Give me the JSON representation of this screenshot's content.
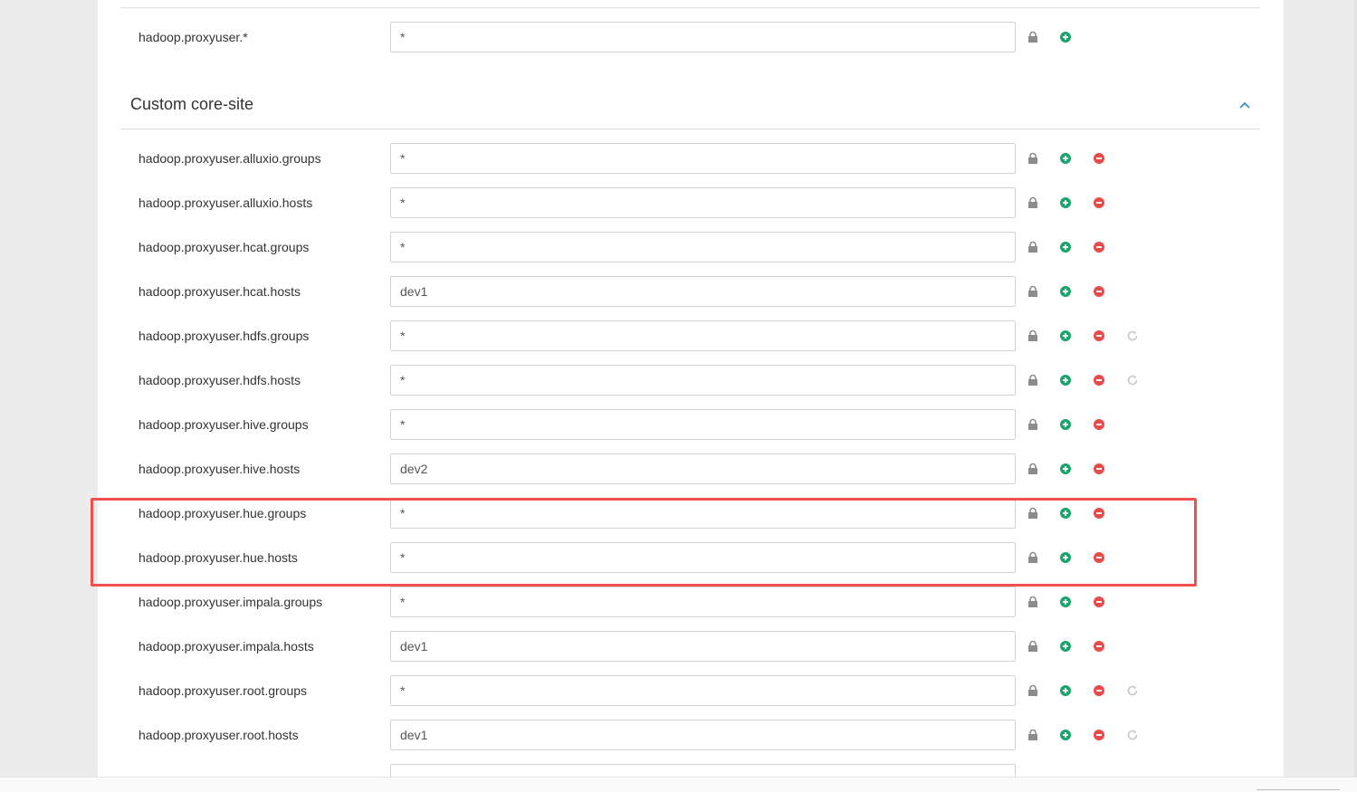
{
  "top_property": {
    "label": "hadoop.proxyuser.*",
    "value": "*"
  },
  "section": {
    "title": "Custom core-site"
  },
  "properties": [
    {
      "label": "hadoop.proxyuser.alluxio.groups",
      "value": "*"
    },
    {
      "label": "hadoop.proxyuser.alluxio.hosts",
      "value": "*"
    },
    {
      "label": "hadoop.proxyuser.hcat.groups",
      "value": "*"
    },
    {
      "label": "hadoop.proxyuser.hcat.hosts",
      "value": "dev1"
    },
    {
      "label": "hadoop.proxyuser.hdfs.groups",
      "value": "*"
    },
    {
      "label": "hadoop.proxyuser.hdfs.hosts",
      "value": "*"
    },
    {
      "label": "hadoop.proxyuser.hive.groups",
      "value": "*"
    },
    {
      "label": "hadoop.proxyuser.hive.hosts",
      "value": "dev2"
    },
    {
      "label": "hadoop.proxyuser.hue.groups",
      "value": "*"
    },
    {
      "label": "hadoop.proxyuser.hue.hosts",
      "value": "*"
    },
    {
      "label": "hadoop.proxyuser.impala.groups",
      "value": "*"
    },
    {
      "label": "hadoop.proxyuser.impala.hosts",
      "value": "dev1"
    },
    {
      "label": "hadoop.proxyuser.root.groups",
      "value": "*"
    },
    {
      "label": "hadoop.proxyuser.root.hosts",
      "value": "dev1"
    }
  ],
  "icons": {
    "lock": "lock-icon",
    "add": "plus-circle-icon",
    "remove": "minus-circle-icon",
    "undo": "undo-icon",
    "collapse": "chevron-up-icon"
  },
  "colors": {
    "add": "#1aa56b",
    "remove": "#e94b4b",
    "lock": "#8c8c8c",
    "undo": "#c8c8c8",
    "accent": "#3b8fc4",
    "highlight": "#f05050"
  }
}
